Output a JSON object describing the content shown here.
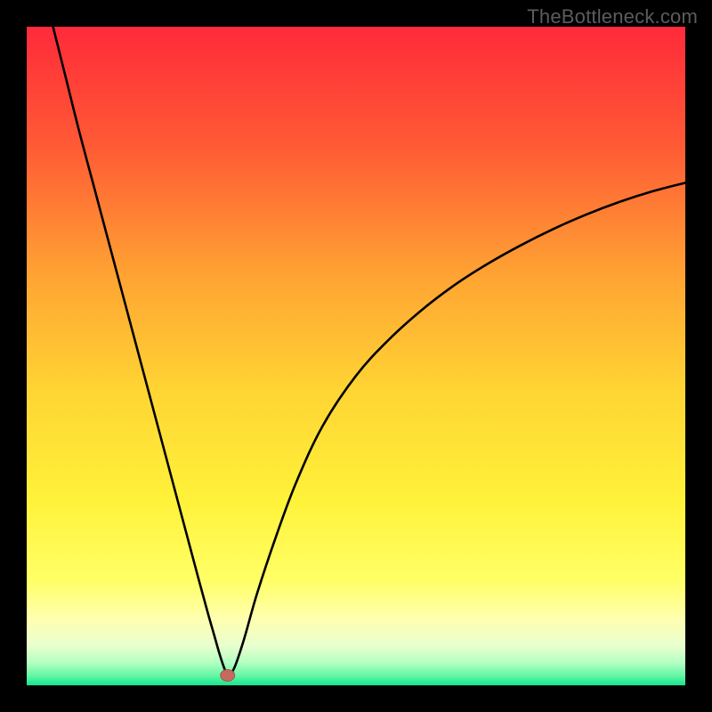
{
  "watermark": "TheBottleneck.com",
  "colors": {
    "frame": "#000000",
    "curve": "#000000",
    "marker_fill": "#c46a5f",
    "marker_stroke": "#a2584e"
  },
  "chart_data": {
    "type": "line",
    "title": "",
    "xlabel": "",
    "ylabel": "",
    "xlim": [
      0,
      100
    ],
    "ylim": [
      0,
      100
    ],
    "gradient_stops": [
      {
        "offset": 0.0,
        "color": "#ff2a3a"
      },
      {
        "offset": 0.18,
        "color": "#ff5a35"
      },
      {
        "offset": 0.38,
        "color": "#ffa433"
      },
      {
        "offset": 0.55,
        "color": "#ffd433"
      },
      {
        "offset": 0.72,
        "color": "#fff23a"
      },
      {
        "offset": 0.84,
        "color": "#ffff66"
      },
      {
        "offset": 0.9,
        "color": "#ffffb0"
      },
      {
        "offset": 0.94,
        "color": "#e8ffce"
      },
      {
        "offset": 0.965,
        "color": "#b6ffc3"
      },
      {
        "offset": 0.985,
        "color": "#66f7a6"
      },
      {
        "offset": 1.0,
        "color": "#14e58e"
      }
    ],
    "minimum_marker": {
      "x": 30.5,
      "y": 1.5
    },
    "series": [
      {
        "name": "bottleneck-curve",
        "x": [
          4,
          6,
          8,
          10,
          12,
          14,
          16,
          18,
          20,
          22,
          24,
          26,
          27.5,
          28.5,
          29.3,
          30,
          30.5,
          31.5,
          33,
          35,
          38,
          41,
          45,
          50,
          55,
          60,
          65,
          70,
          75,
          80,
          85,
          90,
          95,
          100
        ],
        "y": [
          100,
          92,
          84,
          76.5,
          69,
          61.5,
          54,
          46.5,
          39,
          31.5,
          24,
          16.5,
          11,
          7.5,
          4.7,
          2.6,
          1.5,
          2.6,
          7,
          14,
          23,
          31,
          39.5,
          47,
          52.5,
          57,
          60.8,
          64,
          66.8,
          69.3,
          71.5,
          73.4,
          75,
          76.3
        ]
      }
    ]
  }
}
